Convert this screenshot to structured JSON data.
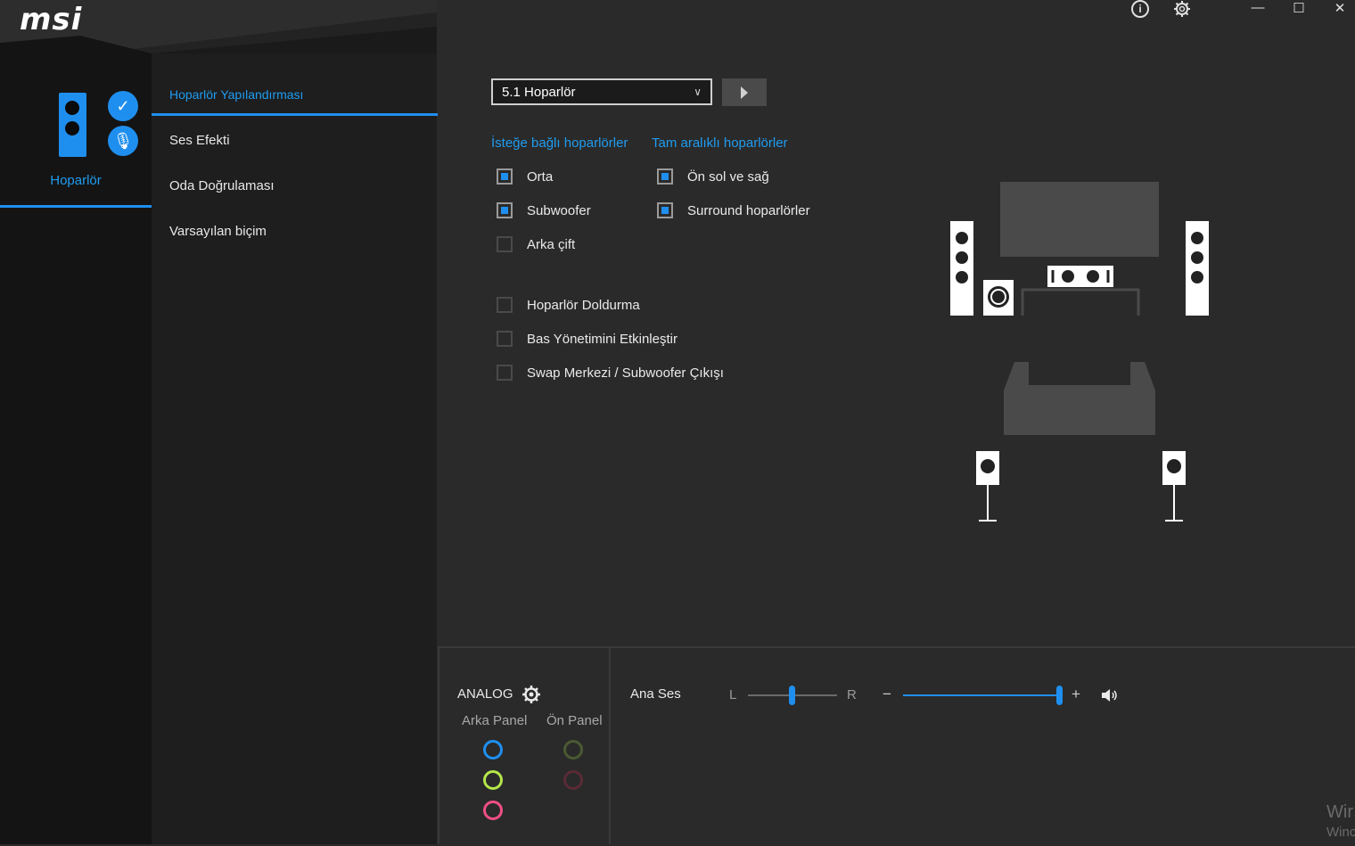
{
  "app": {
    "logo_text": "msi"
  },
  "rail": {
    "device_label": "Hoparlör"
  },
  "menu": {
    "items": [
      {
        "label": "Hoparlör Yapılandırması",
        "active": true
      },
      {
        "label": "Ses Efekti",
        "active": false
      },
      {
        "label": "Oda Doğrulaması",
        "active": false
      },
      {
        "label": "Varsayılan biçim",
        "active": false
      }
    ]
  },
  "toolbar": {
    "info_icon": "info-icon",
    "settings_icon": "gear-icon",
    "minimize": "—",
    "maximize": "☐",
    "close": "✕"
  },
  "config": {
    "speaker_select": "5.1 Hoparlör",
    "optional_header": "İsteğe bağlı hoparlörler",
    "fullrange_header": "Tam aralıklı hoparlörler",
    "optional": [
      {
        "label": "Orta",
        "checked": true
      },
      {
        "label": "Subwoofer",
        "checked": true
      },
      {
        "label": "Arka çift",
        "checked": false
      }
    ],
    "fullrange": [
      {
        "label": "Ön sol ve sağ",
        "checked": true
      },
      {
        "label": "Surround hoparlörler",
        "checked": true
      }
    ],
    "extras": [
      {
        "label": "Hoparlör Doldurma",
        "checked": false
      },
      {
        "label": "Bas Yönetimini Etkinleştir",
        "checked": false
      },
      {
        "label": "Swap Merkezi / Subwoofer Çıkışı",
        "checked": false
      }
    ]
  },
  "bottom": {
    "analog_label": "ANALOG",
    "rear_panel": "Arka Panel",
    "front_panel": "Ön Panel",
    "rear_jacks": [
      "#1f8fef",
      "#b4e64a",
      "#ef4f86"
    ],
    "front_jacks": [
      "#4a5a32",
      "#5a2a36"
    ],
    "master_label": "Ana Ses",
    "balance_left": "L",
    "balance_right": "R",
    "balance_value": 0.5,
    "volume_minus": "−",
    "volume_plus": "+",
    "volume_value": 1.0
  },
  "watermark": {
    "line1": "Wir",
    "line2": "Winc"
  },
  "colors": {
    "accent": "#1f8fef",
    "background": "#2a2a2a"
  }
}
